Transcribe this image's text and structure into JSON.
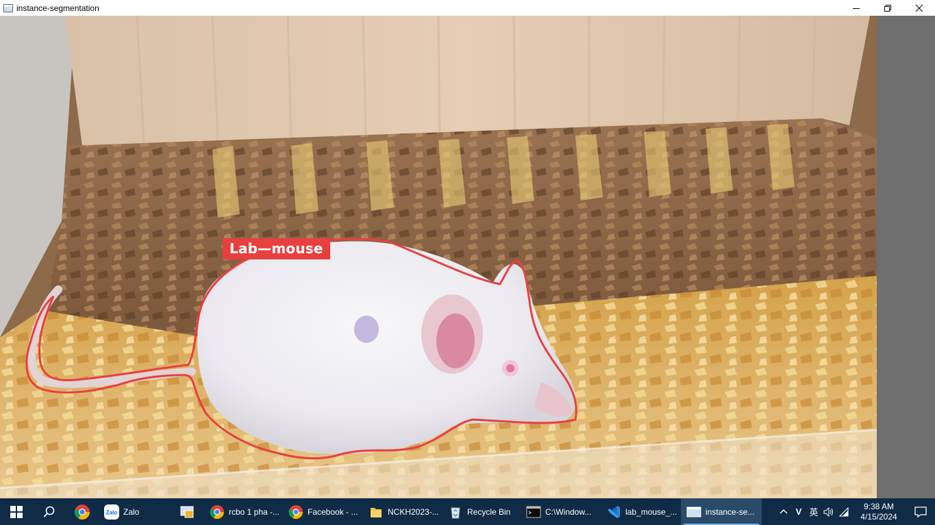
{
  "window": {
    "title": "instance-segmentation",
    "minimize_glyph": "—",
    "maximize_glyph": "❐",
    "close_glyph": "✕"
  },
  "detection": {
    "label": "Lab—mouse",
    "color": "#e8403f"
  },
  "taskbar": {
    "items": [
      {
        "label": "Zalo",
        "icon": "zalo-icon"
      },
      {
        "label": "",
        "icon": "remote-desktop-icon"
      },
      {
        "label": "rcbo 1 pha -...",
        "icon": "chrome-icon"
      },
      {
        "label": "Facebook - ...",
        "icon": "chrome-icon"
      },
      {
        "label": "NCKH2023-...",
        "icon": "folder-icon"
      },
      {
        "label": "Recycle Bin",
        "icon": "recycle-bin-icon"
      },
      {
        "label": "C:\\Window...",
        "icon": "terminal-icon"
      },
      {
        "label": "lab_mouse_...",
        "icon": "vscode-icon"
      },
      {
        "label": "instance-se...",
        "icon": "app-window-icon"
      }
    ],
    "tray": {
      "chevron": "^",
      "v_icon": "V",
      "ime": "英",
      "time": "9:38 AM",
      "date": "4/15/2024"
    }
  }
}
